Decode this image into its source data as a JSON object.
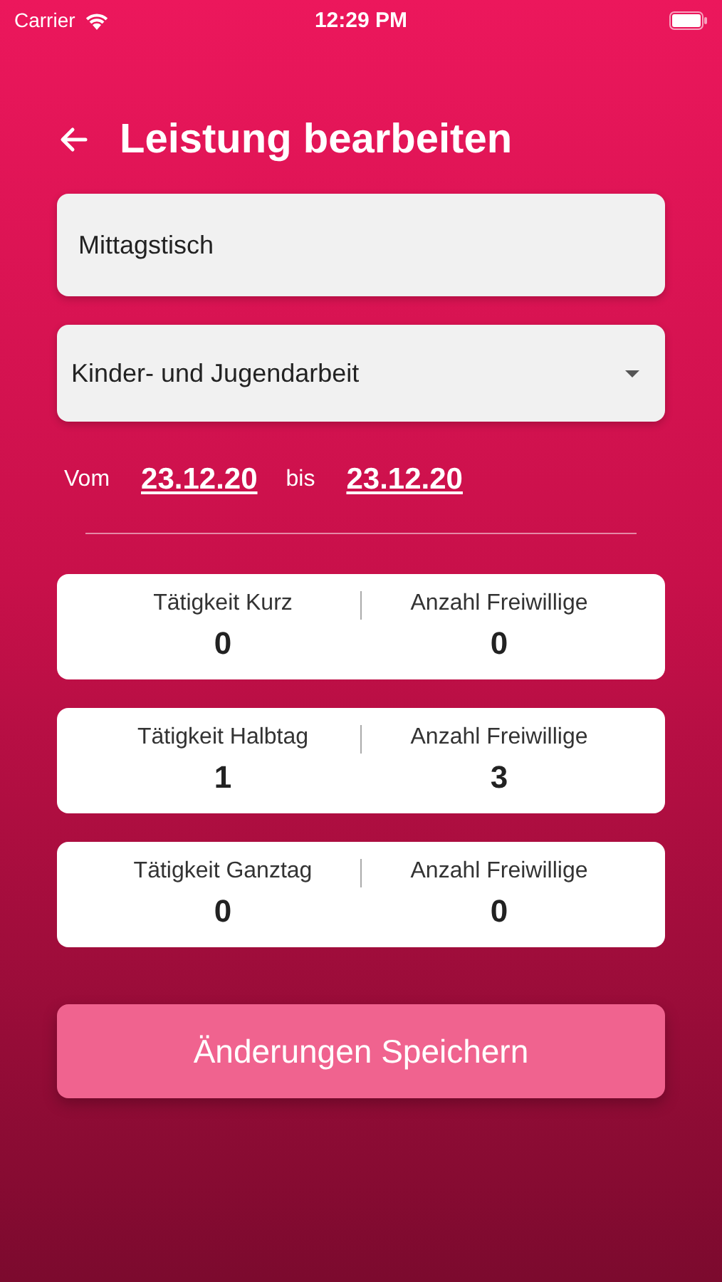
{
  "status_bar": {
    "carrier": "Carrier",
    "time": "12:29 PM"
  },
  "header": {
    "title": "Leistung bearbeiten"
  },
  "name_field": {
    "value": "Mittagstisch"
  },
  "category_dropdown": {
    "value": "Kinder- und Jugendarbeit"
  },
  "date_range": {
    "from_label": "Vom",
    "from": "23.12.20",
    "to_label": "bis",
    "to": "23.12.20"
  },
  "cards": [
    {
      "activity_label": "Tätigkeit Kurz",
      "activity_value": "0",
      "volunteers_label": "Anzahl Freiwillige",
      "volunteers_value": "0"
    },
    {
      "activity_label": "Tätigkeit Halbtag",
      "activity_value": "1",
      "volunteers_label": "Anzahl Freiwillige",
      "volunteers_value": "3"
    },
    {
      "activity_label": "Tätigkeit Ganztag",
      "activity_value": "0",
      "volunteers_label": "Anzahl Freiwillige",
      "volunteers_value": "0"
    }
  ],
  "save_button": {
    "label": "Änderungen Speichern"
  }
}
